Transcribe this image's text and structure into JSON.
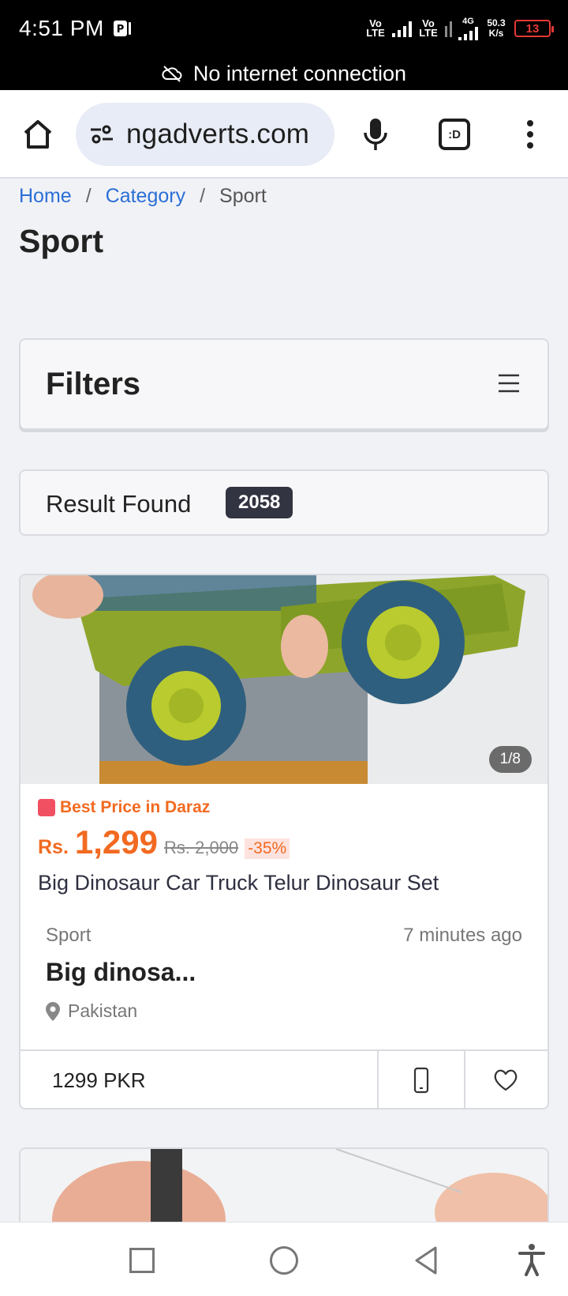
{
  "status_bar": {
    "time": "4:51 PM",
    "volte1": "Vo LTE",
    "volte2": "Vo LTE",
    "network_type": "4G",
    "speed_value": "50.3",
    "speed_unit": "K/s",
    "battery": "13"
  },
  "offline_banner": {
    "text": "No internet connection"
  },
  "browser": {
    "url": "ngadverts.com",
    "tab_count": ":D"
  },
  "breadcrumb": {
    "home": "Home",
    "category": "Category",
    "current": "Sport",
    "separator": "/"
  },
  "page": {
    "title": "Sport"
  },
  "filters": {
    "title": "Filters"
  },
  "results": {
    "label": "Result Found",
    "count": "2058"
  },
  "listing": {
    "image_counter": "1/8",
    "promo_badge": "Best Price in Daraz",
    "price_currency": "Rs.",
    "price": "1,299",
    "old_price": "Rs. 2,000",
    "discount": "-35%",
    "promo_name": "Big Dinosaur Car Truck Telur Dinosaur Set",
    "category": "Sport",
    "posted": "7 minutes ago",
    "title": "Big dinosa...",
    "location": "Pakistan",
    "footer_price": "1299 PKR"
  },
  "colors": {
    "accent_link": "#2b6fd6",
    "price_orange": "#f26a21",
    "badge_dark": "#323442",
    "battery_red": "#e53935"
  }
}
